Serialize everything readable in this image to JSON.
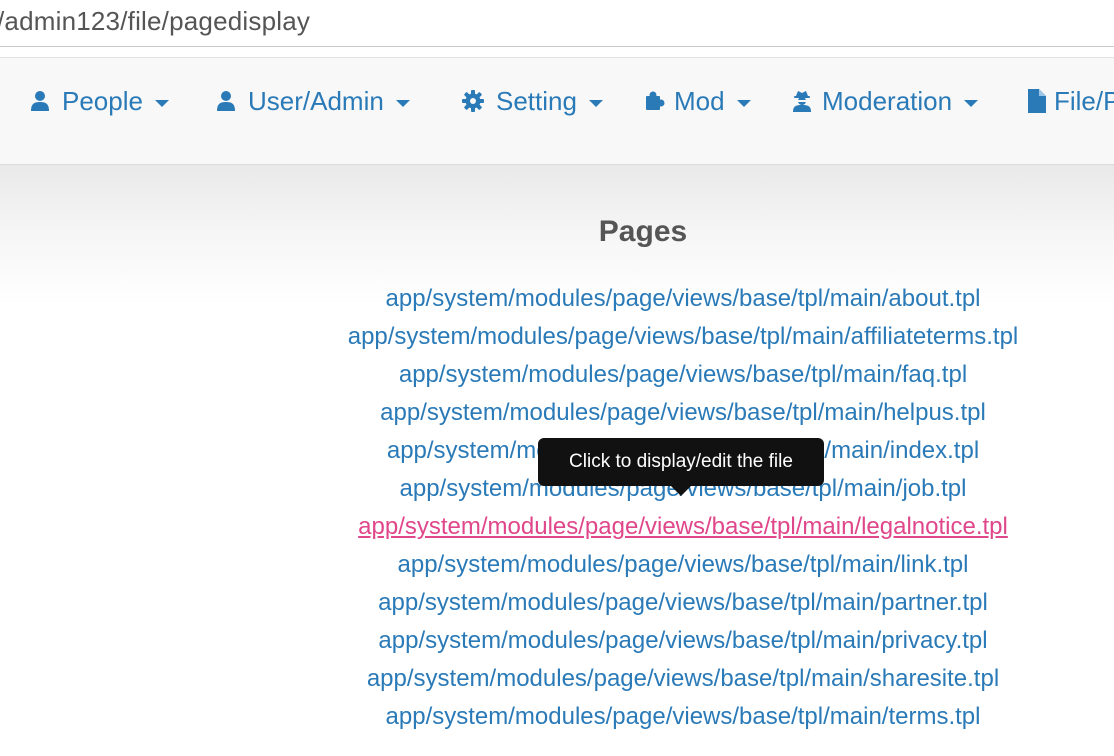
{
  "browser": {
    "url": "/admin123/file/pagedisplay"
  },
  "nav": {
    "items": [
      {
        "label": "People",
        "icon": "user-icon"
      },
      {
        "label": "User/Admin",
        "icon": "user-icon"
      },
      {
        "label": "Setting",
        "icon": "gear-icon"
      },
      {
        "label": "Mod",
        "icon": "puzzle-icon"
      },
      {
        "label": "Moderation",
        "icon": "user-secret-icon"
      },
      {
        "label": "File/P",
        "icon": "file-icon"
      }
    ]
  },
  "main": {
    "title": "Pages",
    "files": [
      "app/system/modules/page/views/base/tpl/main/about.tpl",
      "app/system/modules/page/views/base/tpl/main/affiliateterms.tpl",
      "app/system/modules/page/views/base/tpl/main/faq.tpl",
      "app/system/modules/page/views/base/tpl/main/helpus.tpl",
      "app/system/modules/page/views/base/tpl/main/index.tpl",
      "app/system/modules/page/views/base/tpl/main/job.tpl",
      "app/system/modules/page/views/base/tpl/main/legalnotice.tpl",
      "app/system/modules/page/views/base/tpl/main/link.tpl",
      "app/system/modules/page/views/base/tpl/main/partner.tpl",
      "app/system/modules/page/views/base/tpl/main/privacy.tpl",
      "app/system/modules/page/views/base/tpl/main/sharesite.tpl",
      "app/system/modules/page/views/base/tpl/main/terms.tpl"
    ],
    "hovered_file": "app/system/modules/page/views/base/tpl/main/legalnotice.tpl"
  },
  "tooltip": {
    "text": "Click to display/edit the file"
  },
  "colors": {
    "link": "#2a7ab8",
    "link_hover": "#e0468a",
    "tooltip_bg": "#111111"
  }
}
